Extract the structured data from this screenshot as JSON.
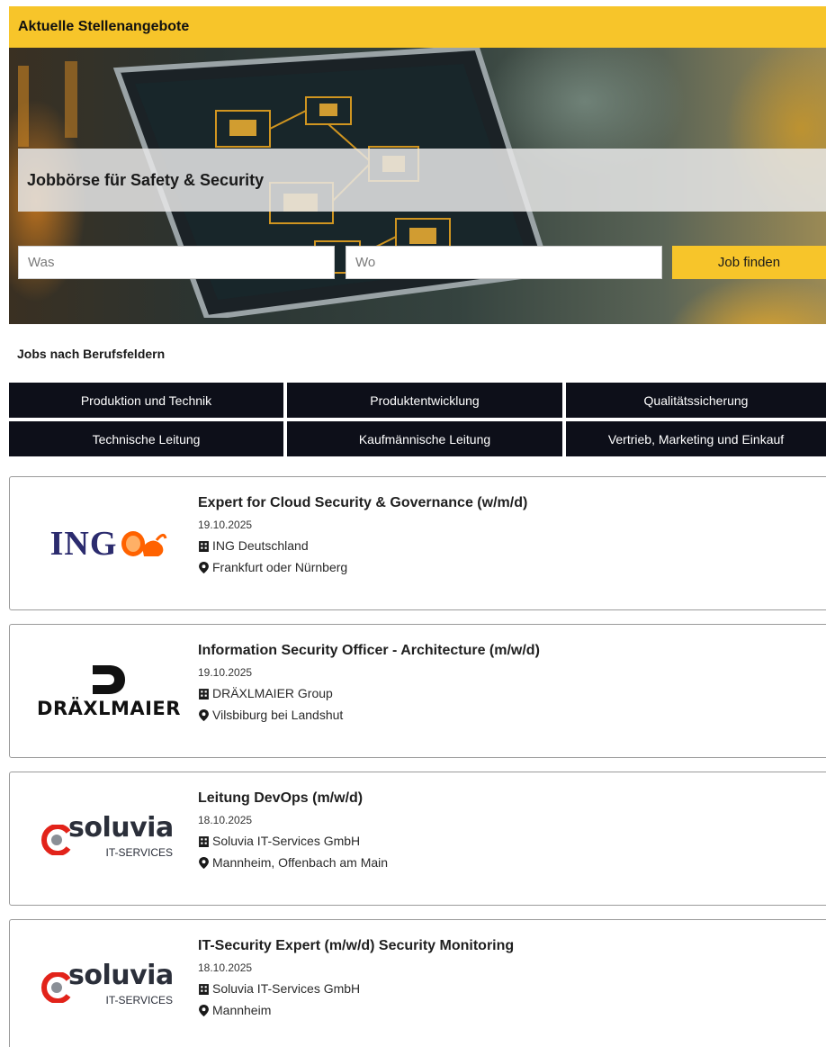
{
  "header": {
    "title": "Aktuelle Stellenangebote"
  },
  "hero": {
    "title": "Jobbörse für Safety & Security",
    "search_what_placeholder": "Was",
    "search_where_placeholder": "Wo",
    "search_button": "Job finden"
  },
  "categories": {
    "label": "Jobs nach Berufsfeldern",
    "items": [
      {
        "label": "Produktion und Technik"
      },
      {
        "label": "Produktentwicklung"
      },
      {
        "label": "Qualitätssicherung"
      },
      {
        "label": "Technische Leitung"
      },
      {
        "label": "Kaufmännische Leitung"
      },
      {
        "label": "Vertrieb, Marketing und Einkauf"
      }
    ]
  },
  "jobs": [
    {
      "title": "Expert for Cloud Security & Governance (w/m/d)",
      "date": "19.10.2025",
      "company": "ING Deutschland",
      "location": "Frankfurt oder Nürnberg",
      "logo_text": "ING",
      "logo_color": "#2b2b6e",
      "logo_accent": "#ff6200"
    },
    {
      "title": "Information Security Officer - Architecture (m/w/d)",
      "date": "19.10.2025",
      "company": "DRÄXLMAIER Group",
      "location": "Vilsbiburg bei Landshut",
      "logo_text": "DRÄXLMAIER",
      "logo_color": "#111111"
    },
    {
      "title": "Leitung DevOps (m/w/d)",
      "date": "18.10.2025",
      "company": "Soluvia IT-Services GmbH",
      "location": "Mannheim, Offenbach am Main",
      "logo_text": "soluvia",
      "logo_subtext": "IT-SERVICES",
      "logo_color": "#2b2f3a",
      "logo_accent": "#e2231a"
    },
    {
      "title": "IT-Security Expert (m/w/d) Security Monitoring",
      "date": "18.10.2025",
      "company": "Soluvia IT-Services GmbH",
      "location": "Mannheim",
      "logo_text": "soluvia",
      "logo_subtext": "IT-SERVICES",
      "logo_color": "#2b2f3a",
      "logo_accent": "#e2231a"
    }
  ],
  "colors": {
    "accent": "#f7c52a",
    "category_bg": "#0d0f19"
  },
  "icons": {
    "company": "building-icon",
    "location": "map-pin-icon"
  }
}
